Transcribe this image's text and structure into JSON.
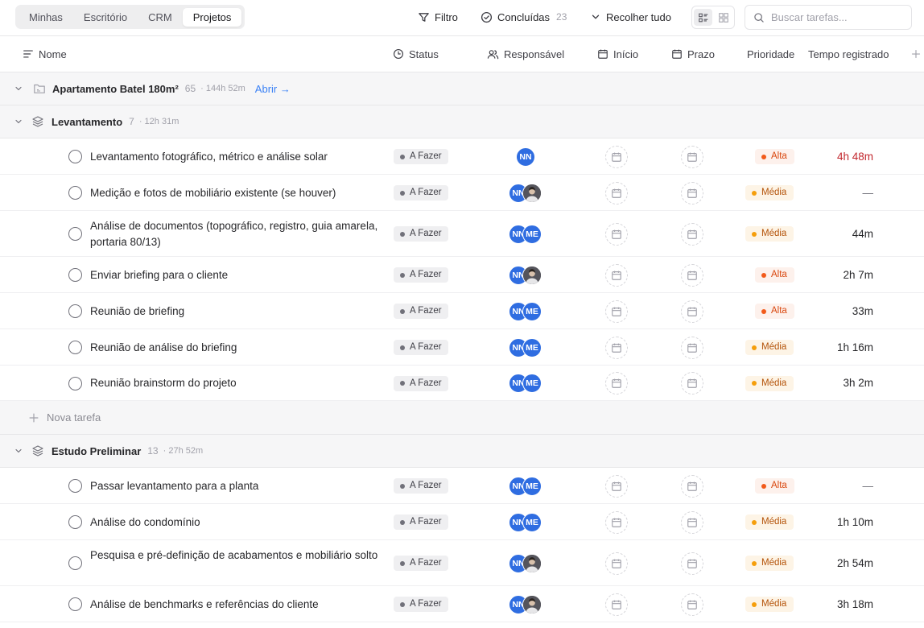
{
  "tabs": [
    {
      "label": "Minhas",
      "active": false
    },
    {
      "label": "Escritório",
      "active": false
    },
    {
      "label": "CRM",
      "active": false
    },
    {
      "label": "Projetos",
      "active": true
    }
  ],
  "toolbar": {
    "filter_label": "Filtro",
    "completed_label": "Concluídas",
    "completed_count": "23",
    "collapse_label": "Recolher tudo",
    "search_placeholder": "Buscar tarefas..."
  },
  "columns": {
    "name": "Nome",
    "status": "Status",
    "assignee": "Responsável",
    "start": "Início",
    "due": "Prazo",
    "priority": "Prioridade",
    "time": "Tempo registrado"
  },
  "project": {
    "title": "Apartamento Batel 180m²",
    "count": "65",
    "time": "· 144h 52m",
    "open_label": "Abrir →"
  },
  "sections": [
    {
      "title": "Levantamento",
      "count": "7",
      "time": "· 12h 31m",
      "tasks": [
        {
          "name": "Levantamento fotográfico, métrico e análise solar",
          "status": "A Fazer",
          "assignees": [
            "NN"
          ],
          "priority": "Alta",
          "time": "4h 48m"
        },
        {
          "name": "Medição e fotos de mobiliário existente (se houver)",
          "status": "A Fazer",
          "assignees": [
            "NN",
            "photo"
          ],
          "priority": "Média",
          "time": "—"
        },
        {
          "name": "Análise de documentos (topográfico, registro, guia amarela, portaria 80/13)",
          "status": "A Fazer",
          "assignees": [
            "NN",
            "ME"
          ],
          "priority": "Média",
          "time": "44m"
        },
        {
          "name": "Enviar briefing para o cliente",
          "status": "A Fazer",
          "assignees": [
            "NN",
            "photo"
          ],
          "priority": "Alta",
          "time": "2h 7m"
        },
        {
          "name": "Reunião de briefing",
          "status": "A Fazer",
          "assignees": [
            "NN",
            "ME"
          ],
          "priority": "Alta",
          "time": "33m"
        },
        {
          "name": "Reunião de análise do briefing",
          "status": "A Fazer",
          "assignees": [
            "NN",
            "ME"
          ],
          "priority": "Média",
          "time": "1h 16m"
        },
        {
          "name": "Reunião brainstorm do projeto",
          "status": "A Fazer",
          "assignees": [
            "NN",
            "ME"
          ],
          "priority": "Média",
          "time": "3h 2m"
        }
      ],
      "new_task_label": "Nova tarefa"
    },
    {
      "title": "Estudo Preliminar",
      "count": "13",
      "time": "· 27h 52m",
      "tasks": [
        {
          "name": "Passar levantamento para a planta",
          "status": "A Fazer",
          "assignees": [
            "NN",
            "ME"
          ],
          "priority": "Alta",
          "time": "—"
        },
        {
          "name": "Análise do condomínio",
          "status": "A Fazer",
          "assignees": [
            "NN",
            "ME"
          ],
          "priority": "Média",
          "time": "1h 10m"
        },
        {
          "name": "Pesquisa e pré-definição de acabamentos e mobiliário solto",
          "status": "A Fazer",
          "assignees": [
            "NN",
            "photo"
          ],
          "priority": "Média",
          "time": "2h 54m"
        },
        {
          "name": "Análise de benchmarks e referências do cliente",
          "status": "A Fazer",
          "assignees": [
            "NN",
            "photo"
          ],
          "priority": "Média",
          "time": "3h 18m"
        }
      ]
    }
  ],
  "colors": {
    "accent_blue": "#2f6de1",
    "link_blue": "#3b82f6",
    "alta": "#f25a1a",
    "media": "#f59e0b",
    "overtime_red": "#c2272d"
  }
}
